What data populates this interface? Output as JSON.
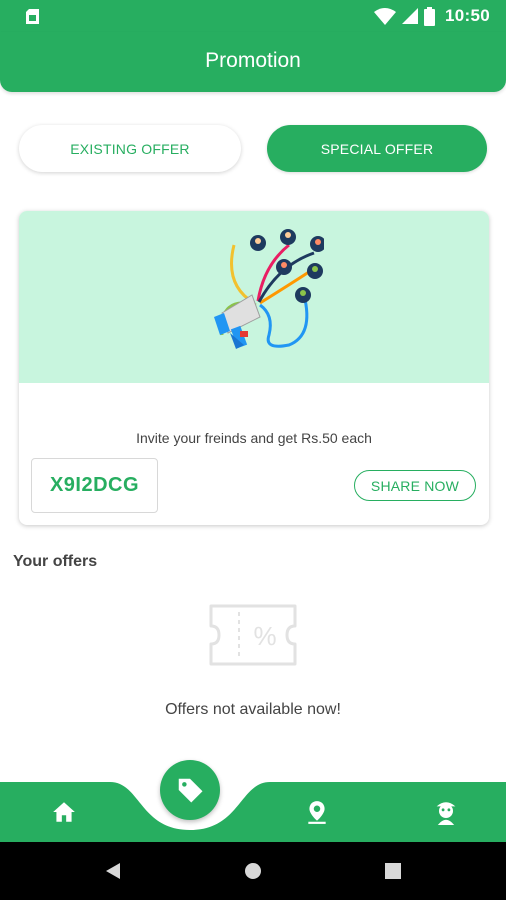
{
  "status_bar": {
    "time": "10:50",
    "icons": [
      "sim-card-icon",
      "wifi-icon",
      "signal-icon",
      "battery-icon"
    ]
  },
  "app_bar": {
    "title": "Promotion"
  },
  "tabs": [
    {
      "label": "EXISTING OFFER",
      "selected": false
    },
    {
      "label": "SPECIAL OFFER",
      "selected": true
    }
  ],
  "referral": {
    "illustration": "megaphone-referral-illustration",
    "invite_text": "Invite your freinds and get Rs.50 each",
    "code": "X9I2DCG",
    "share_label": "SHARE NOW"
  },
  "offers": {
    "section_title": "Your offers",
    "empty_icon": "discount-coupon-icon",
    "empty_text": "Offers not available now!"
  },
  "bottom_nav": {
    "items": [
      "home-icon",
      "offers-tag-icon",
      "location-pin-icon",
      "profile-avatar-icon"
    ],
    "selected": "offers-tag-icon"
  },
  "system_nav": [
    "back-icon",
    "home-circle-icon",
    "recents-icon"
  ],
  "colors": {
    "primary": "#27ae60",
    "banner": "#c8f5de",
    "text": "#444444"
  }
}
